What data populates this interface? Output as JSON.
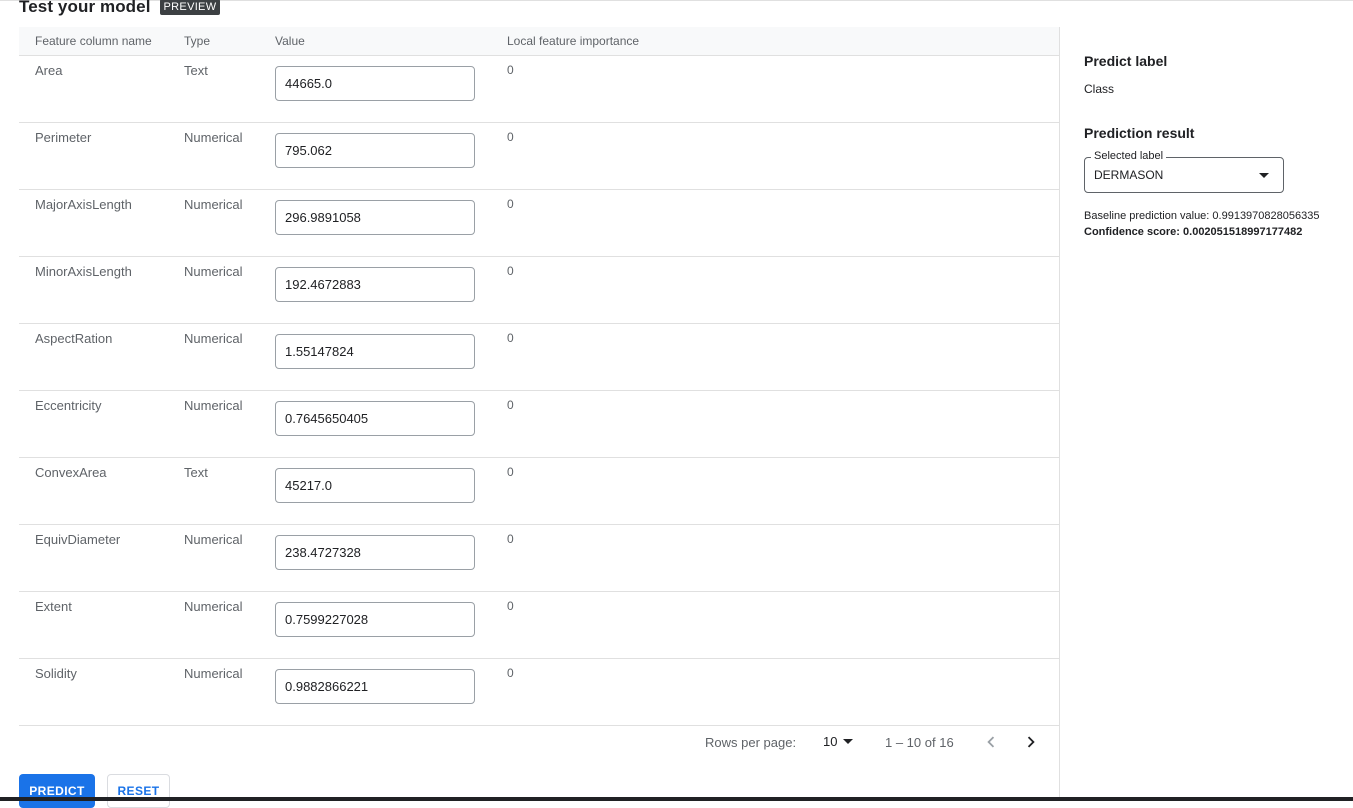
{
  "header": {
    "title": "Test your model",
    "badge": "PREVIEW"
  },
  "table": {
    "columns": [
      "Feature column name",
      "Type",
      "Value",
      "Local feature importance"
    ],
    "rows": [
      {
        "name": "Area",
        "type": "Text",
        "value": "44665.0",
        "importance": "0"
      },
      {
        "name": "Perimeter",
        "type": "Numerical",
        "value": "795.062",
        "importance": "0"
      },
      {
        "name": "MajorAxisLength",
        "type": "Numerical",
        "value": "296.9891058",
        "importance": "0"
      },
      {
        "name": "MinorAxisLength",
        "type": "Numerical",
        "value": "192.4672883",
        "importance": "0"
      },
      {
        "name": "AspectRation",
        "type": "Numerical",
        "value": "1.55147824",
        "importance": "0"
      },
      {
        "name": "Eccentricity",
        "type": "Numerical",
        "value": "0.7645650405",
        "importance": "0"
      },
      {
        "name": "ConvexArea",
        "type": "Text",
        "value": "45217.0",
        "importance": "0"
      },
      {
        "name": "EquivDiameter",
        "type": "Numerical",
        "value": "238.4727328",
        "importance": "0"
      },
      {
        "name": "Extent",
        "type": "Numerical",
        "value": "0.7599227028",
        "importance": "0"
      },
      {
        "name": "Solidity",
        "type": "Numerical",
        "value": "0.9882866221",
        "importance": "0"
      }
    ]
  },
  "pagination": {
    "rows_per_page_label": "Rows per page:",
    "rows_per_page_value": "10",
    "range": "1 – 10 of 16",
    "prev_icon": "chevron-left-icon",
    "next_icon": "chevron-right-icon"
  },
  "actions": {
    "predict": "PREDICT",
    "reset": "RESET"
  },
  "sidebar": {
    "predict_label_heading": "Predict label",
    "predict_label_value": "Class",
    "prediction_result_heading": "Prediction result",
    "selected_label_legend": "Selected label",
    "selected_label_value": "DERMASON",
    "baseline": "Baseline prediction value: 0.9913970828056335",
    "confidence": "Confidence score: 0.002051518997177482"
  },
  "colors": {
    "primary": "#1a73e8",
    "badge_bg": "#3c4043",
    "border": "#e0e0e0"
  }
}
